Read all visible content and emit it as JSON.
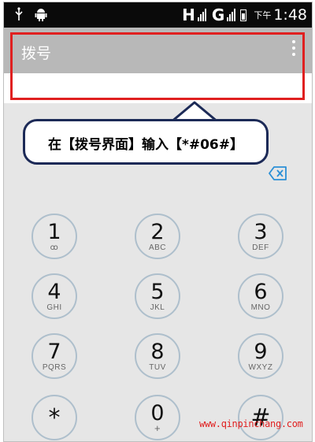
{
  "status_bar": {
    "network_h": "H",
    "network_g": "G",
    "clock_prefix": "下午",
    "time": "1:48"
  },
  "app_bar": {
    "title": "拨号",
    "menu_icon": "overflow-menu-icon"
  },
  "callout": {
    "text": "在【拨号界面】输入【*#06#】"
  },
  "dialpad": {
    "keys": [
      {
        "digit": "1",
        "letters": "ꝏ"
      },
      {
        "digit": "2",
        "letters": "ABC"
      },
      {
        "digit": "3",
        "letters": "DEF"
      },
      {
        "digit": "4",
        "letters": "GHI"
      },
      {
        "digit": "5",
        "letters": "JKL"
      },
      {
        "digit": "6",
        "letters": "MNO"
      },
      {
        "digit": "7",
        "letters": "PQRS"
      },
      {
        "digit": "8",
        "letters": "TUV"
      },
      {
        "digit": "9",
        "letters": "WXYZ"
      },
      {
        "digit": "*",
        "letters": ""
      },
      {
        "digit": "0",
        "letters": "+"
      },
      {
        "digit": "#",
        "letters": ""
      }
    ]
  },
  "colors": {
    "status_bar": "#0a0a0a",
    "app_bar": "#b8b8b8",
    "dialpad_bg": "#e6e6e6",
    "highlight": "#e02020",
    "callout_border": "#1c2a57",
    "backspace": "#2b8fd6"
  },
  "watermark": "www.qinpinchang.com"
}
